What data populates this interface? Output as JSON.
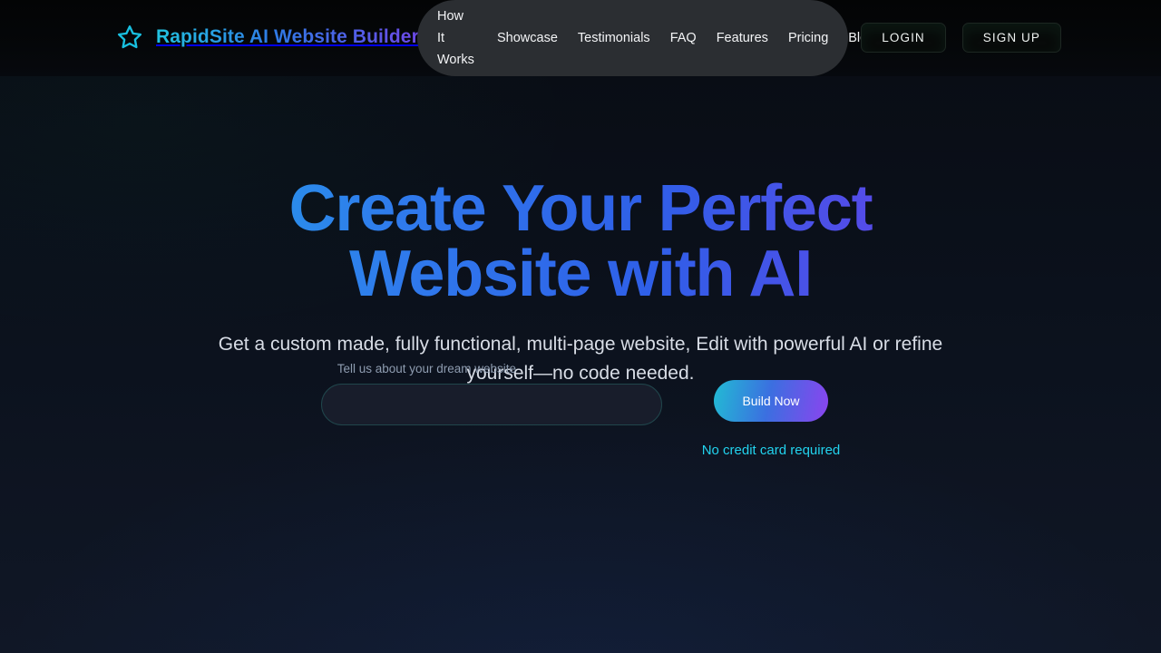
{
  "brand": {
    "name": "RapidSite AI Website Builder",
    "logo_icon": "star-icon",
    "logo_color": "#22c3e0",
    "gradient_from": "#22c3e0",
    "gradient_to": "#6d49e8"
  },
  "nav": {
    "items": [
      {
        "label": "How It Works"
      },
      {
        "label": "Showcase"
      },
      {
        "label": "Testimonials"
      },
      {
        "label": "FAQ"
      },
      {
        "label": "Features"
      },
      {
        "label": "Pricing"
      },
      {
        "label": "Blog"
      }
    ]
  },
  "auth": {
    "login_label": "LOGIN",
    "signup_label": "SIGN UP"
  },
  "hero": {
    "headline_line1": "Create Your Perfect",
    "headline_line2": "Website with AI",
    "subhead": "Get a custom made, fully functional, multi-page website, Edit with powerful AI or refine yourself—no code needed.",
    "headline_gradient_from": "#1fb6e6",
    "headline_gradient_to": "#7c3aed"
  },
  "form": {
    "label": "Tell us about your dream website",
    "input_value": "",
    "input_placeholder": "",
    "cta_label": "Build Now",
    "cta_note": "No credit card required",
    "cta_note_color": "#22d3ee"
  },
  "theme": {
    "page_background": "#0b111c",
    "header_background": "#050709",
    "nav_pill_background": "#2b2e32",
    "input_background": "#181d2b",
    "input_border": "#20464c"
  }
}
